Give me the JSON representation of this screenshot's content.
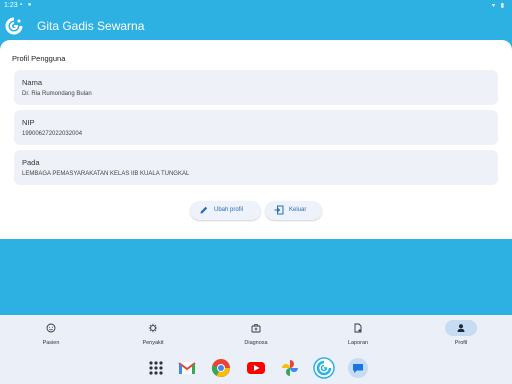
{
  "status_bar": {
    "time": "1:23",
    "left_icons": "▪ ●",
    "right_icons": "▾ ▮"
  },
  "app": {
    "title": "Gita Gadis Sewarna",
    "logo_icon": "gita-logo-icon"
  },
  "profile": {
    "section_title": "Profil Pengguna",
    "fields": [
      {
        "label": "Nama",
        "value": "Dr. Ria Rumondang Bulan"
      },
      {
        "label": "NIP",
        "value": "199006272022032004"
      },
      {
        "label": "Pada",
        "value": "LEMBAGA PEMASYARAKATAN KELAS IIB KUALA TUNGKAL"
      }
    ],
    "edit_button": "Ubah profil",
    "logout_button": "Keluar"
  },
  "nav": {
    "items": [
      {
        "label": "Pasien",
        "icon": "patient-face-icon",
        "active": false
      },
      {
        "label": "Penyakit",
        "icon": "virus-icon",
        "active": false
      },
      {
        "label": "Diagnosa",
        "icon": "diagnosis-kit-icon",
        "active": false
      },
      {
        "label": "Laporan",
        "icon": "report-file-icon",
        "active": false
      },
      {
        "label": "Profil",
        "icon": "person-icon",
        "active": true
      }
    ]
  },
  "taskbar": {
    "apps": [
      "app-drawer-icon",
      "gmail-icon",
      "chrome-icon",
      "youtube-icon",
      "photos-icon",
      "gita-app-icon",
      "messages-icon"
    ]
  },
  "colors": {
    "primary": "#2db1e3",
    "accent": "#2a6bb5",
    "card": "#eef1f8",
    "nav": "#eaeff8",
    "active_pill": "#c5dcf3"
  }
}
